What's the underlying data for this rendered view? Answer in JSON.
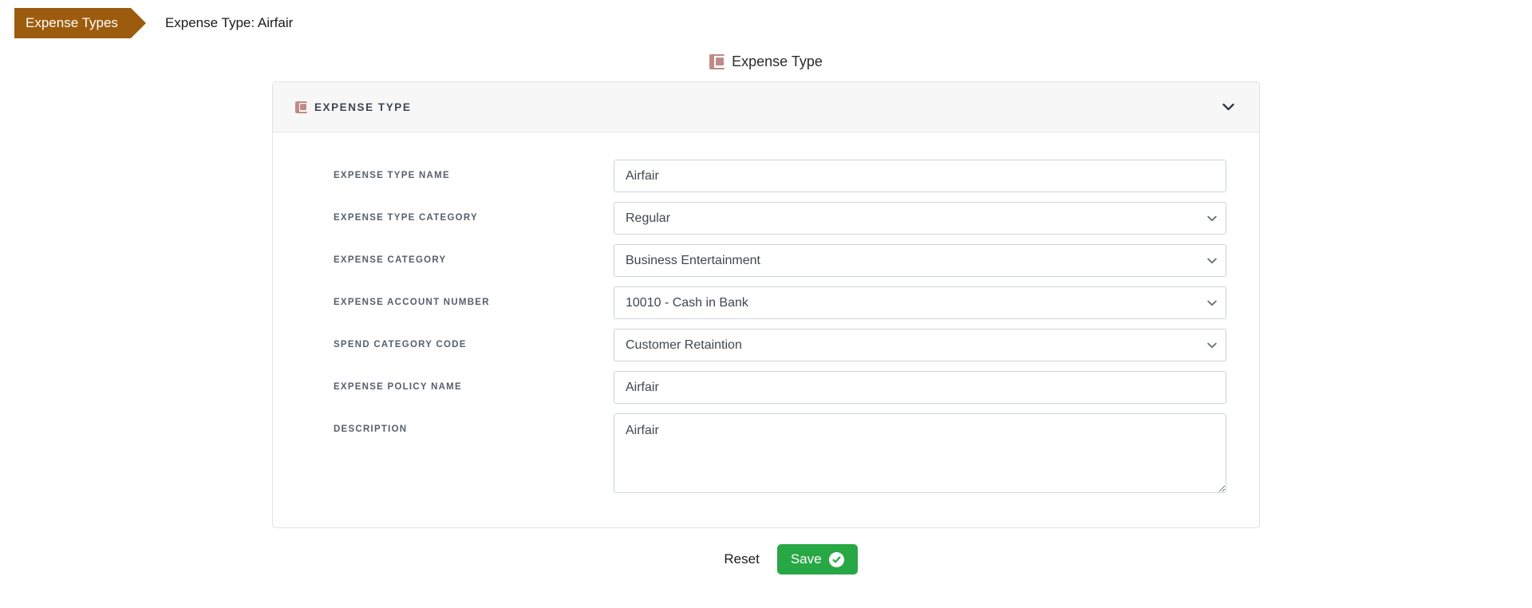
{
  "breadcrumb": {
    "active_label": "Expense Types",
    "sub_label": "Expense Type: Airfair",
    "active_bg": "#9d5c0d"
  },
  "page_title": {
    "text": "Expense Type",
    "icon": "expense-type-icon",
    "icon_color": "#c08a87"
  },
  "panel": {
    "title": "EXPENSE TYPE",
    "icon": "expense-type-icon",
    "collapse_icon": "chevron-down-icon",
    "header_bg": "#f7f7f7"
  },
  "form": {
    "fields": [
      {
        "label": "EXPENSE TYPE NAME",
        "type": "text",
        "value": "Airfair",
        "placeholder": "",
        "name": "expense-type-name"
      },
      {
        "label": "EXPENSE TYPE CATEGORY",
        "type": "select",
        "value": "Regular",
        "options": [
          "Regular"
        ],
        "name": "expense-type-category"
      },
      {
        "label": "EXPENSE CATEGORY",
        "type": "select",
        "value": "Business Entertainment",
        "options": [
          "Business Entertainment"
        ],
        "name": "expense-category"
      },
      {
        "label": "EXPENSE ACCOUNT NUMBER",
        "type": "select",
        "value": "10010 - Cash in Bank",
        "options": [
          "10010 - Cash in Bank"
        ],
        "name": "expense-account-number"
      },
      {
        "label": "SPEND CATEGORY CODE",
        "type": "select",
        "value": "Customer Retaintion",
        "options": [
          "Customer Retaintion"
        ],
        "name": "spend-category-code"
      },
      {
        "label": "EXPENSE POLICY NAME",
        "type": "text",
        "value": "Airfair",
        "placeholder": "",
        "name": "expense-policy-name"
      },
      {
        "label": "DESCRIPTION",
        "type": "textarea",
        "value": "Airfair",
        "placeholder": "",
        "name": "description"
      }
    ]
  },
  "footer": {
    "reset_label": "Reset",
    "save_label": "Save",
    "save_icon": "check-circle-icon",
    "save_color": "#28a745"
  }
}
